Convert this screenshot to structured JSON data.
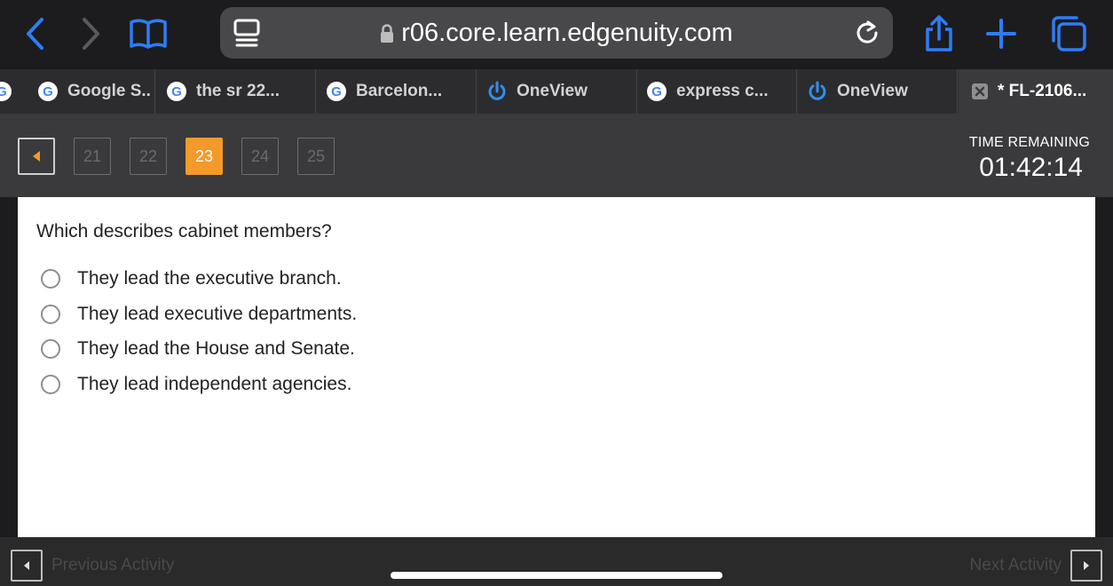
{
  "browser": {
    "url": "r06.core.learn.edgenuity.com",
    "tabs": [
      {
        "label": "Google S..",
        "icon": "google-icon"
      },
      {
        "label": "the sr 22...",
        "icon": "google-icon"
      },
      {
        "label": "Barcelon...",
        "icon": "google-icon"
      },
      {
        "label": "OneView",
        "icon": "power-icon"
      },
      {
        "label": "express c...",
        "icon": "google-icon"
      },
      {
        "label": "OneView",
        "icon": "power-icon"
      },
      {
        "label": "* FL-2106...",
        "icon": "close-icon",
        "active": true
      }
    ]
  },
  "quiz_nav": {
    "pages": [
      "21",
      "22",
      "23",
      "24",
      "25"
    ],
    "current": "23",
    "time_label": "TIME REMAINING",
    "time_value": "01:42:14"
  },
  "question": {
    "text": "Which describes cabinet members?",
    "options": [
      "They lead the executive branch.",
      "They lead executive departments.",
      "They lead the House and Senate.",
      "They lead independent agencies."
    ]
  },
  "footer": {
    "previous_label": "Previous Activity",
    "next_label": "Next Activity"
  },
  "colors": {
    "accent": "#f39a2b",
    "safari_blue": "#2f7cf6"
  }
}
